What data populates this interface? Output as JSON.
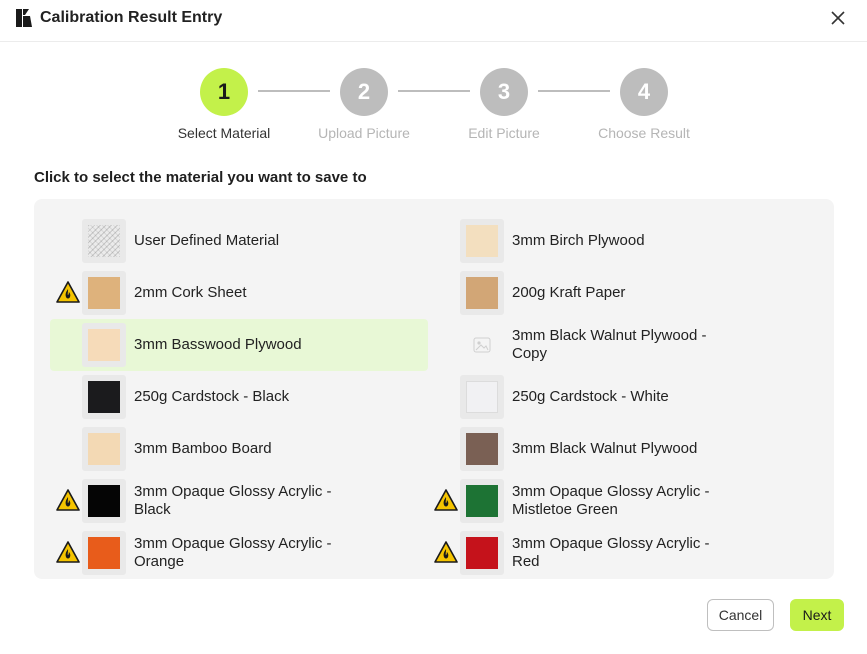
{
  "dialog": {
    "title": "Calibration Result Entry"
  },
  "steps": [
    {
      "number": "1",
      "label": "Select Material",
      "state": "active"
    },
    {
      "number": "2",
      "label": "Upload Picture",
      "state": "inactive"
    },
    {
      "number": "3",
      "label": "Edit Picture",
      "state": "inactive"
    },
    {
      "number": "4",
      "label": "Choose Result",
      "state": "inactive"
    }
  ],
  "prompt": "Click to select the material you want to save to",
  "materials": [
    {
      "name": "User Defined Material",
      "swatch": "pattern-grid",
      "warning": false,
      "selected": false
    },
    {
      "name": "3mm Birch Plywood",
      "swatch": "#f3dfbf",
      "warning": false,
      "selected": false
    },
    {
      "name": "2mm Cork Sheet",
      "swatch": "#deb27c",
      "warning": true,
      "selected": false
    },
    {
      "name": "200g Kraft Paper",
      "swatch": "#d2a676",
      "warning": false,
      "selected": false
    },
    {
      "name": "3mm Basswood Plywood",
      "swatch": "#f6dbb9",
      "warning": false,
      "selected": true
    },
    {
      "name": "3mm Black Walnut Plywood - Copy",
      "swatch": "placeholder-image",
      "warning": false,
      "selected": false
    },
    {
      "name": "250g Cardstock - Black",
      "swatch": "#1b1b1d",
      "warning": false,
      "selected": false
    },
    {
      "name": "250g Cardstock - White",
      "swatch": "#f1f1f3",
      "warning": false,
      "selected": false
    },
    {
      "name": "3mm Bamboo Board",
      "swatch": "#f3d9b4",
      "warning": false,
      "selected": false
    },
    {
      "name": "3mm Black Walnut Plywood",
      "swatch": "#7a6054",
      "warning": false,
      "selected": false
    },
    {
      "name": "3mm Opaque Glossy Acrylic - Black",
      "swatch": "#050505",
      "warning": true,
      "selected": false
    },
    {
      "name": "3mm Opaque Glossy Acrylic - Mistletoe Green",
      "swatch": "#1d7334",
      "warning": true,
      "selected": false
    },
    {
      "name": "3mm Opaque Glossy Acrylic - Orange",
      "swatch": "#e85c1b",
      "warning": true,
      "selected": false
    },
    {
      "name": "3mm Opaque Glossy Acrylic - Red",
      "swatch": "#c5121b",
      "warning": true,
      "selected": false
    }
  ],
  "buttons": {
    "cancel": "Cancel",
    "next": "Next"
  },
  "colors": {
    "accent": "#c3f14a",
    "selected_row": "#e8f8d6",
    "warning": "#f5c400"
  },
  "icons": {
    "logo": "app-logo-icon",
    "close": "close-icon",
    "warning": "laser-hazard-warning-icon"
  }
}
